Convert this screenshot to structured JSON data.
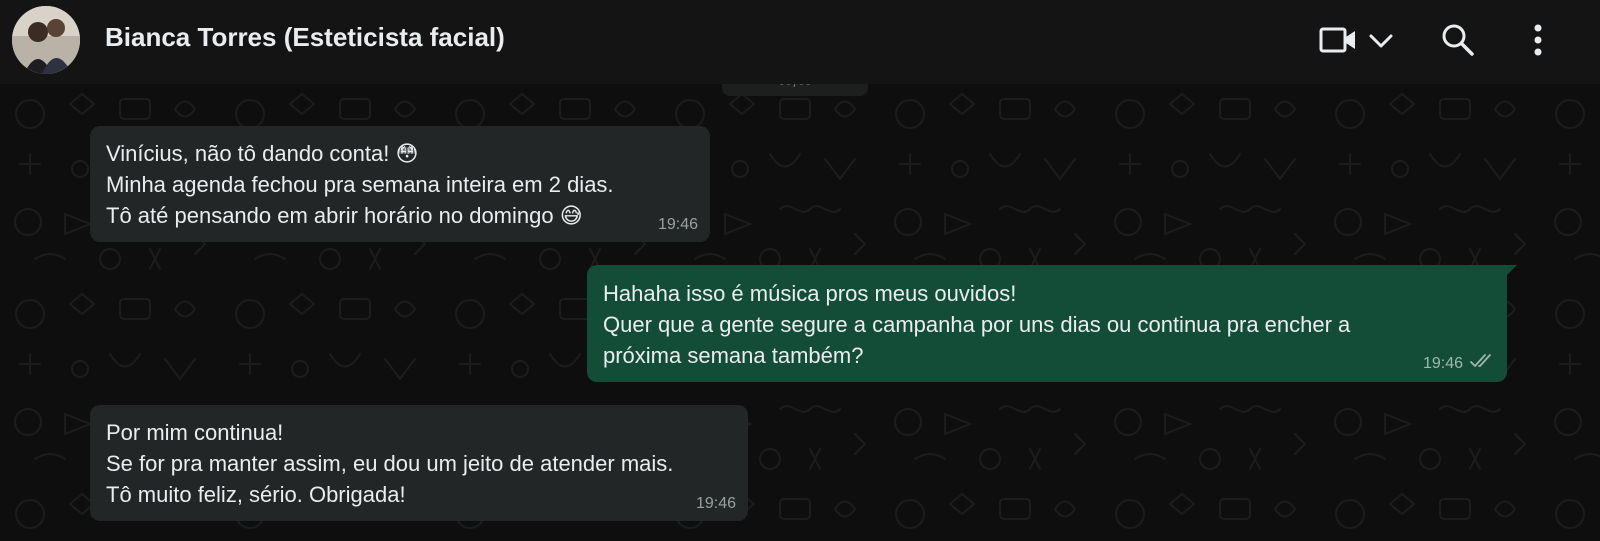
{
  "header": {
    "contact_name": "Bianca Torres (Esteticista facial)",
    "icons": [
      "video-call-icon",
      "chevron-down-icon",
      "search-icon",
      "more-vert-icon"
    ]
  },
  "date_chip": {
    "label": "- - / - -"
  },
  "messages": [
    {
      "direction": "incoming",
      "lines": [
        "Vinícius, não tô dando conta! 😳",
        "Minha agenda fechou pra semana inteira em 2 dias.",
        "Tô até pensando em abrir horário no domingo 😅"
      ],
      "time": "19:46"
    },
    {
      "direction": "outgoing",
      "lines": [
        "Hahaha isso é música pros meus ouvidos!",
        "Quer que a gente segure a campanha por uns dias ou continua pra encher a",
        "próxima semana também?"
      ],
      "time": "19:46",
      "status": "read-double-check"
    },
    {
      "direction": "incoming",
      "lines": [
        "Por mim continua!",
        "Se for pra manter assim, eu dou um jeito de atender mais.",
        "Tô muito feliz, sério. Obrigada!"
      ],
      "time": "19:46"
    }
  ],
  "colors": {
    "header_bg": "#141414",
    "wallpaper_bg": "#0e0e0e",
    "incoming_bubble": "#232626",
    "outgoing_bubble": "#144d37",
    "text": "#e9edef",
    "meta_text": "#9aa0a2"
  }
}
